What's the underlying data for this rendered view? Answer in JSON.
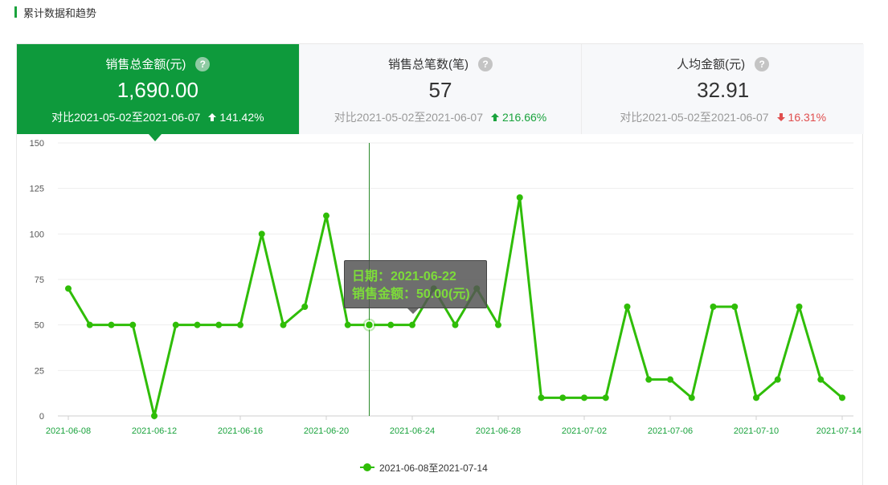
{
  "section": {
    "title": "累计数据和趋势"
  },
  "metrics": [
    {
      "title": "销售总金额(元)",
      "value": "1,690.00",
      "compare": "对比2021-05-02至2021-06-07",
      "change": "141.42%",
      "direction": "up",
      "active": true
    },
    {
      "title": "销售总笔数(笔)",
      "value": "57",
      "compare": "对比2021-05-02至2021-06-07",
      "change": "216.66%",
      "direction": "up",
      "active": false
    },
    {
      "title": "人均金额(元)",
      "value": "32.91",
      "compare": "对比2021-05-02至2021-06-07",
      "change": "16.31%",
      "direction": "down",
      "active": false
    }
  ],
  "help_glyph": "?",
  "colors": {
    "accent": "#0e9a3c",
    "line": "#2fbd07",
    "up": "#1aa33d",
    "down": "#e04e4e",
    "label": "#1aa33d"
  },
  "chart_data": {
    "type": "line",
    "ylim": [
      0,
      150
    ],
    "yticks": [
      0,
      25,
      50,
      75,
      100,
      125,
      150
    ],
    "x": [
      "2021-06-08",
      "2021-06-09",
      "2021-06-10",
      "2021-06-11",
      "2021-06-12",
      "2021-06-13",
      "2021-06-14",
      "2021-06-15",
      "2021-06-16",
      "2021-06-17",
      "2021-06-18",
      "2021-06-19",
      "2021-06-20",
      "2021-06-21",
      "2021-06-22",
      "2021-06-23",
      "2021-06-24",
      "2021-06-25",
      "2021-06-26",
      "2021-06-27",
      "2021-06-28",
      "2021-06-29",
      "2021-06-30",
      "2021-07-01",
      "2021-07-02",
      "2021-07-03",
      "2021-07-04",
      "2021-07-05",
      "2021-07-06",
      "2021-07-07",
      "2021-07-08",
      "2021-07-09",
      "2021-07-10",
      "2021-07-11",
      "2021-07-12",
      "2021-07-13",
      "2021-07-14"
    ],
    "xtick_labels": [
      "2021-06-08",
      "2021-06-12",
      "2021-06-16",
      "2021-06-20",
      "2021-06-24",
      "2021-06-28",
      "2021-07-02",
      "2021-07-06",
      "2021-07-10",
      "2021-07-14"
    ],
    "series": [
      {
        "name": "2021-06-08至2021-07-14",
        "values": [
          70,
          50,
          50,
          50,
          0,
          50,
          50,
          50,
          50,
          100,
          50,
          60,
          110,
          50,
          50,
          50,
          50,
          70,
          50,
          70,
          50,
          120,
          10,
          10,
          10,
          10,
          60,
          20,
          20,
          10,
          60,
          60,
          10,
          20,
          60,
          20,
          10
        ]
      }
    ],
    "grid": true,
    "legend": "bottom-center",
    "highlight": {
      "x": "2021-06-22",
      "value": 50
    }
  },
  "tooltip": {
    "date_line": "日期：2021-06-22",
    "value_line": "销售金额：50.00(元)"
  }
}
